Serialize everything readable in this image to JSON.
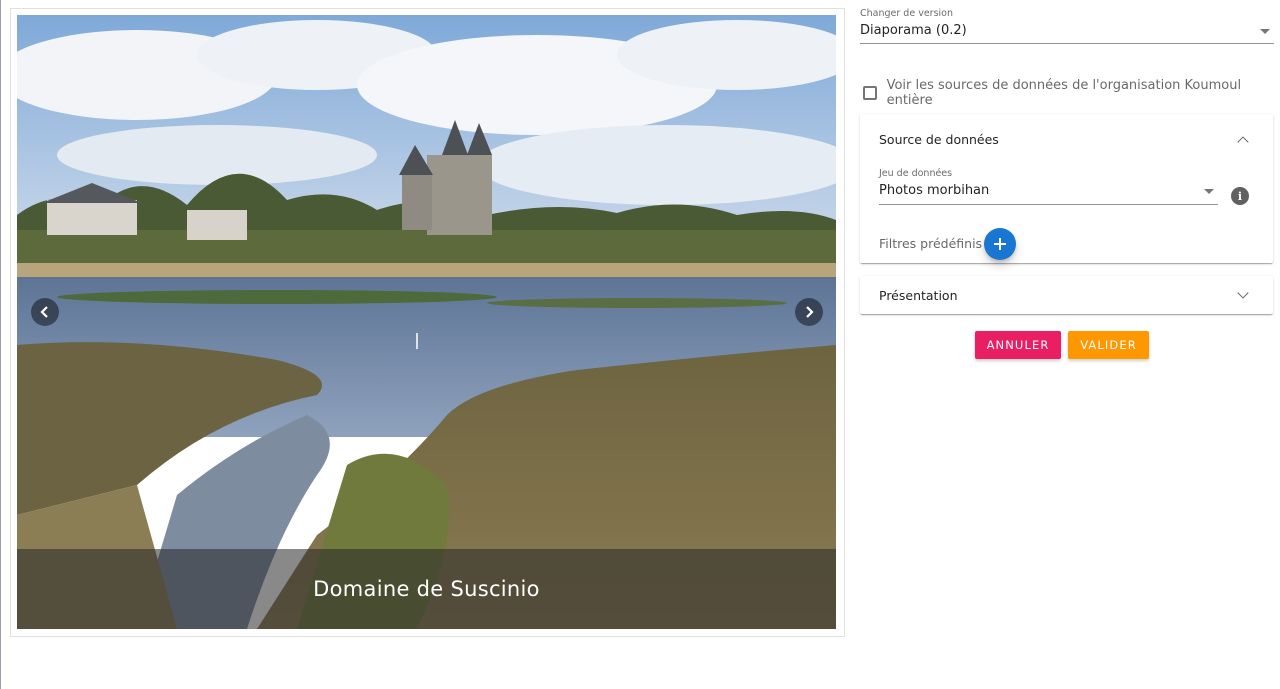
{
  "slideshow": {
    "caption": "Domaine de Suscinio",
    "prev_icon": "chevron-left-icon",
    "next_icon": "chevron-right-icon"
  },
  "version": {
    "label": "Changer de version",
    "value": "Diaporama (0.2)"
  },
  "organization_checkbox": {
    "label": "Voir les sources de données de l'organisation Koumoul entière",
    "checked": false
  },
  "data_source_panel": {
    "title": "Source de données",
    "expanded": true,
    "dataset_label": "Jeu de données",
    "dataset_value": "Photos morbihan",
    "filters_label": "Filtres prédéfinis",
    "add_icon": "plus-icon",
    "info_icon": "info-icon"
  },
  "presentation_panel": {
    "title": "Présentation",
    "expanded": false
  },
  "actions": {
    "cancel": "ANNULER",
    "validate": "VALIDER"
  },
  "colors": {
    "cancel": "#e91e63",
    "validate": "#ff9800",
    "fab": "#1976d2"
  }
}
